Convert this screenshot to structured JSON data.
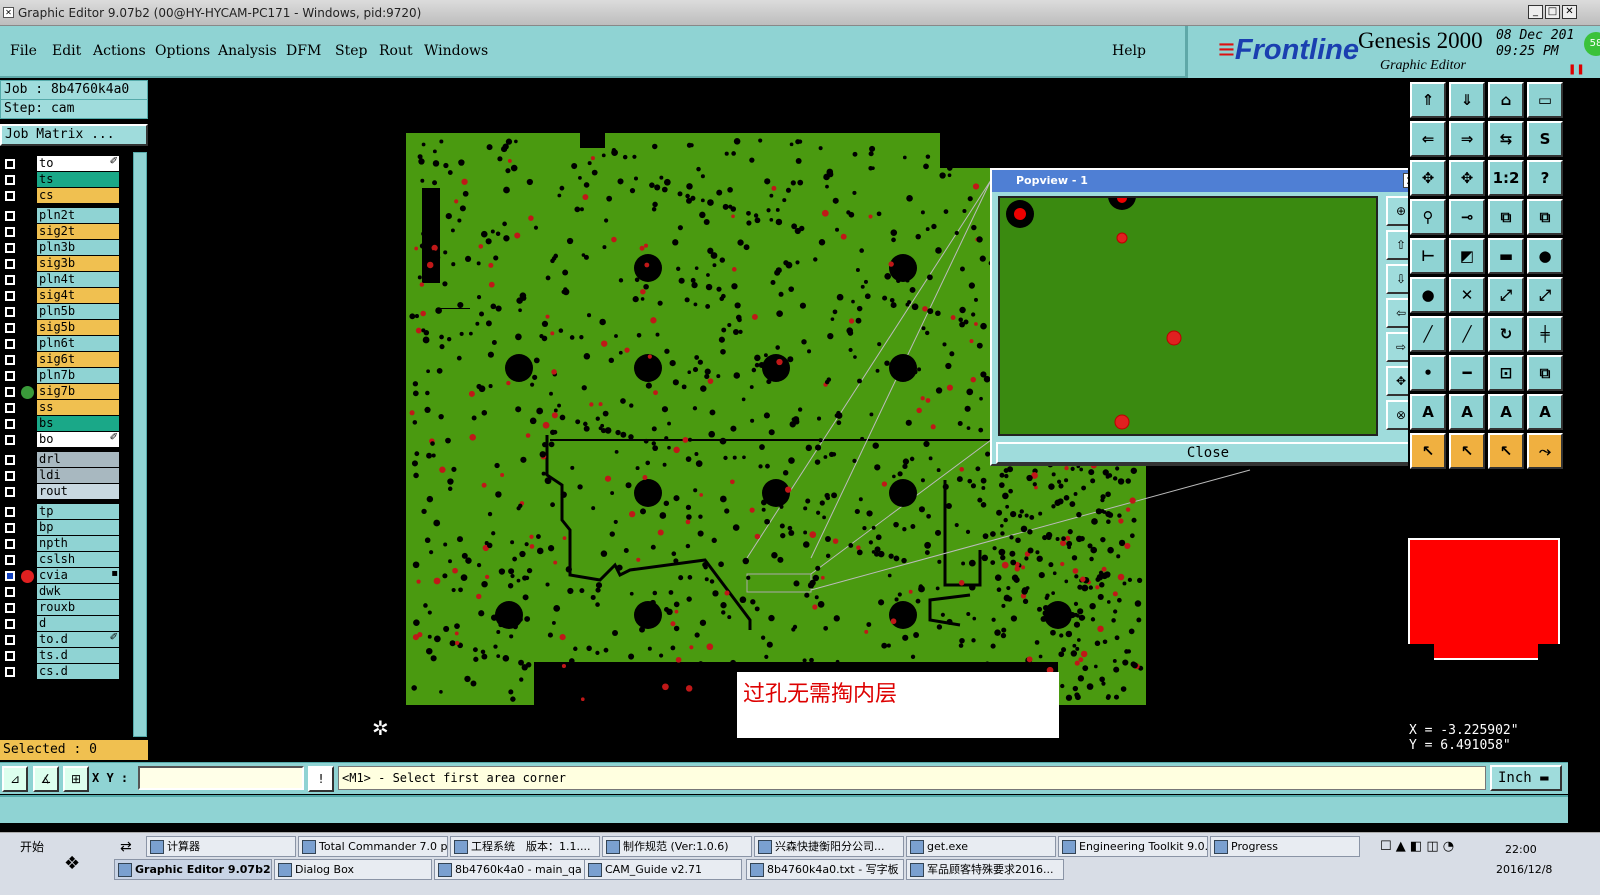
{
  "window": {
    "title": "Graphic Editor 9.07b2 (00@HY-HYCAM-PC171 - Windows, pid:9720)"
  },
  "menu": {
    "file": "File",
    "edit": "Edit",
    "actions": "Actions",
    "options": "Options",
    "analysis": "Analysis",
    "dfm": "DFM",
    "step": "Step",
    "rout": "Rout",
    "windows": "Windows",
    "help": "Help"
  },
  "brand": {
    "frontline": "Frontline",
    "product": "Genesis 2000",
    "subtitle": "Graphic Editor",
    "date": "08 Dec 201",
    "time": "09:25 PM",
    "badge": "58"
  },
  "job": {
    "job": "Job : 8b4760k4a0",
    "step": "Step: cam",
    "matrix": "Job Matrix ..."
  },
  "layers": [
    {
      "name": "to",
      "color": "#ffffff",
      "icon": "✐"
    },
    {
      "name": "ts",
      "color": "#1aa888"
    },
    {
      "name": "cs",
      "color": "#f0c050"
    },
    {
      "name": "pln2t",
      "color": "#8fd3d3"
    },
    {
      "name": "sig2t",
      "color": "#f0c050"
    },
    {
      "name": "pln3b",
      "color": "#8fd3d3"
    },
    {
      "name": "sig3b",
      "color": "#f0c050"
    },
    {
      "name": "pln4t",
      "color": "#8fd3d3"
    },
    {
      "name": "sig4t",
      "color": "#f0c050"
    },
    {
      "name": "pln5b",
      "color": "#8fd3d3"
    },
    {
      "name": "sig5b",
      "color": "#f0c050"
    },
    {
      "name": "pln6t",
      "color": "#8fd3d3"
    },
    {
      "name": "sig6t",
      "color": "#f0c050"
    },
    {
      "name": "pln7b",
      "color": "#8fd3d3"
    },
    {
      "name": "sig7b",
      "color": "#f0c050",
      "dot": "#3a9a3a"
    },
    {
      "name": "ss",
      "color": "#f0c050"
    },
    {
      "name": "bs",
      "color": "#1aa888"
    },
    {
      "name": "bo",
      "color": "#ffffff",
      "icon": "✐"
    },
    {
      "name": "drl",
      "color": "#a8b8c0"
    },
    {
      "name": "ldi",
      "color": "#a8b8c0"
    },
    {
      "name": "rout",
      "color": "#c8d8e0"
    },
    {
      "name": "tp",
      "color": "#8fd3d3"
    },
    {
      "name": "bp",
      "color": "#8fd3d3"
    },
    {
      "name": "npth",
      "color": "#8fd3d3"
    },
    {
      "name": "cslsh",
      "color": "#8fd3d3"
    },
    {
      "name": "cvia",
      "color": "#8fd3d3",
      "dot": "#e02020",
      "active": true,
      "icon": "▪"
    },
    {
      "name": "dwk",
      "color": "#8fd3d3"
    },
    {
      "name": "rouxb",
      "color": "#8fd3d3"
    },
    {
      "name": "d",
      "color": "#8fd3d3"
    },
    {
      "name": "to.d",
      "color": "#8fd3d3",
      "icon": "✐"
    },
    {
      "name": "ts.d",
      "color": "#8fd3d3"
    },
    {
      "name": "cs.d",
      "color": "#8fd3d3"
    }
  ],
  "selected": "Selected : 0",
  "popview": {
    "title": "Popview - 1",
    "close": "Close"
  },
  "note": "过孔无需掏内层",
  "coords": {
    "x": "X = -3.225902\"",
    "y": "Y = 6.491058\""
  },
  "command": {
    "xy_label": "X Y :",
    "prompt": "<M1> - Select first area corner",
    "unit": "Inch"
  },
  "taskbar": {
    "start": "开始",
    "row1": [
      "计算器",
      "Total Commander 7.0 p...",
      "工程系统　版本：1.1....",
      "制作规范 (Ver:1.0.6)",
      "兴森快捷衡阳分公司...",
      "get.exe",
      "Engineering Toolkit 9.0...",
      "Progress"
    ],
    "row2": [
      "Graphic Editor 9.07b2 ...",
      "Dialog Box",
      "8b4760k4a0 - main_qa",
      "CAM_Guide v2.71",
      "8b4760k4a0.txt - 写字板",
      "军品顾客特殊要求2016..."
    ],
    "time": "22:00",
    "date": "2016/12/8"
  },
  "colors": {
    "board": "#4a9a10",
    "pad": "#000000",
    "via": "#e02020",
    "highlight": "#ff0000"
  }
}
